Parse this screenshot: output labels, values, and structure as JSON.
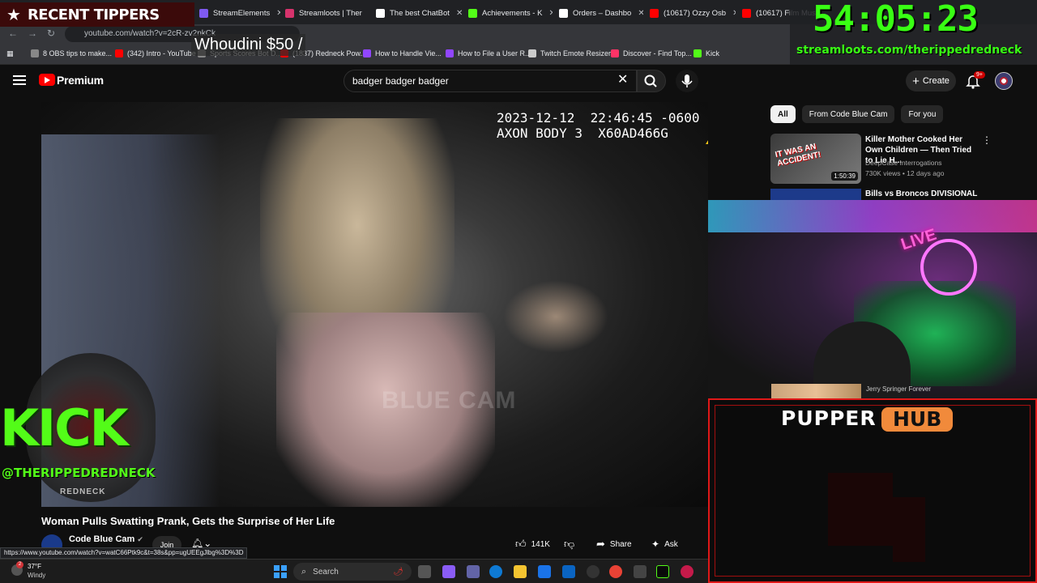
{
  "browser": {
    "tabs": [
      {
        "label": "StreamElements",
        "color": "#7f5af0"
      },
      {
        "label": "Streamloots | Ther",
        "color": "#d6336c"
      },
      {
        "label": "The best ChatBot",
        "color": "#ffffff"
      },
      {
        "label": "Achievements - K",
        "color": "#53fc18"
      },
      {
        "label": "Orders – Dashbo",
        "color": "#ffffff"
      },
      {
        "label": "(10617) Ozzy Osb",
        "color": "#ff0000"
      },
      {
        "label": "(10617) Film Musi",
        "color": "#ff0000"
      },
      {
        "label": "(1",
        "color": "#ff0000"
      }
    ],
    "url": "youtube.com/watch?v=2cR-zv2nkCk",
    "bookmarks": [
      {
        "label": "8 OBS tips to make...",
        "color": "#888888"
      },
      {
        "label": "(342) Intro - YouTube",
        "color": "#ff0000"
      },
      {
        "label": "Sports Scores Bot D...",
        "color": "#888888"
      },
      {
        "label": "(1837) Redneck Pow...",
        "color": "#ff0000"
      },
      {
        "label": "How to Handle Vie...",
        "color": "#9146ff"
      },
      {
        "label": "How to File a User R...",
        "color": "#9146ff"
      },
      {
        "label": "Twitch Emote Resizer",
        "color": "#cccccc"
      },
      {
        "label": "Discover - Find Top...",
        "color": "#ff3366"
      },
      {
        "label": "Kick",
        "color": "#53fc18"
      }
    ]
  },
  "overlays": {
    "recent_tippers_title": "RECENT TIPPERS",
    "latest_tip": "Whoudini $50 /",
    "timer": "54:05:23",
    "streamloots_url": "streamloots.com/therippedredneck",
    "kick_logo_text": "KICK",
    "kick_handle": "@THERIPPEDREDNECK",
    "kick_sub": "REDNECK",
    "pupper_word": "PUPPER",
    "hub_word": "HUB",
    "jerry_label": "Jerry Springer Forever"
  },
  "youtube": {
    "brand": "Premium",
    "search_query": "badger badger badger",
    "create_label": "Create",
    "notif_count": "9+",
    "video": {
      "timestamp_line1": "2023-12-12  22:46:45 -0600",
      "timestamp_line2": "AXON BODY 3  X60AD466G",
      "watermark": "BLUE CAM",
      "title": "Woman Pulls Swatting Prank, Gets the Surprise of Her Life",
      "channel": "Code Blue Cam",
      "join_label": "Join",
      "likes": "141K",
      "share_label": "Share",
      "ask_label": "Ask"
    },
    "chips": [
      "All",
      "From Code Blue Cam",
      "For you"
    ],
    "recommendations": [
      {
        "title": "Killer Mother Cooked Her Own Children — Then Tried to Lie H...",
        "channel": "DeepCase Interrogations",
        "meta": "730K views • 12 days ago",
        "duration": "1:50:39",
        "thumb_text": "IT WAS AN ACCIDENT!"
      },
      {
        "title": "Bills vs Broncos DIVISIONAL"
      }
    ]
  },
  "status_bar_url": "https://www.youtube.com/watch?v=watC66Ptk9c&t=38s&pp=ugUEEgJlbg%3D%3D",
  "taskbar": {
    "temp": "37°F",
    "condition": "Windy",
    "weather_badge": "2",
    "search_label": "Search"
  },
  "colors": {
    "kick_green": "#53fc18",
    "timer_green": "#39ff14",
    "youtube_red": "#ff0000",
    "pupper_red": "#e01818",
    "hub_orange": "#f18a3b"
  }
}
